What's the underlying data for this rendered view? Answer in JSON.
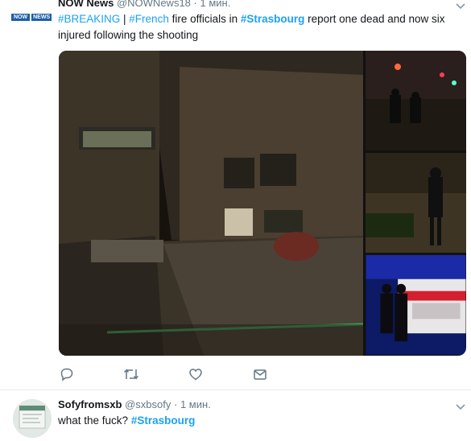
{
  "tweets": [
    {
      "author": {
        "name": "NOW News",
        "handle": "@NOWNews18",
        "avatar_text": [
          "NOW",
          "NEWS"
        ]
      },
      "separator": "·",
      "time": "1 мин.",
      "text": {
        "tag_breaking": "#BREAKING",
        "pipe": " | ",
        "tag_french": "#French",
        "part1": " fire officials in ",
        "tag_strasbourg": "#Strasbourg",
        "part2": " report one dead and now six injured following the shooting"
      },
      "actions": [
        "reply-icon",
        "retweet-icon",
        "like-icon",
        "message-icon"
      ]
    },
    {
      "author": {
        "name": "Sofyfromsxb",
        "handle": "@sxbsofy"
      },
      "separator": "·",
      "time": "1 мин.",
      "text": {
        "part1": "what the fuck? ",
        "tag_strasbourg": "#Strasbourg"
      }
    }
  ],
  "colors": {
    "link": "#1da1f2",
    "meta": "#657786",
    "text": "#14171a",
    "divider": "#e6ecf0"
  }
}
